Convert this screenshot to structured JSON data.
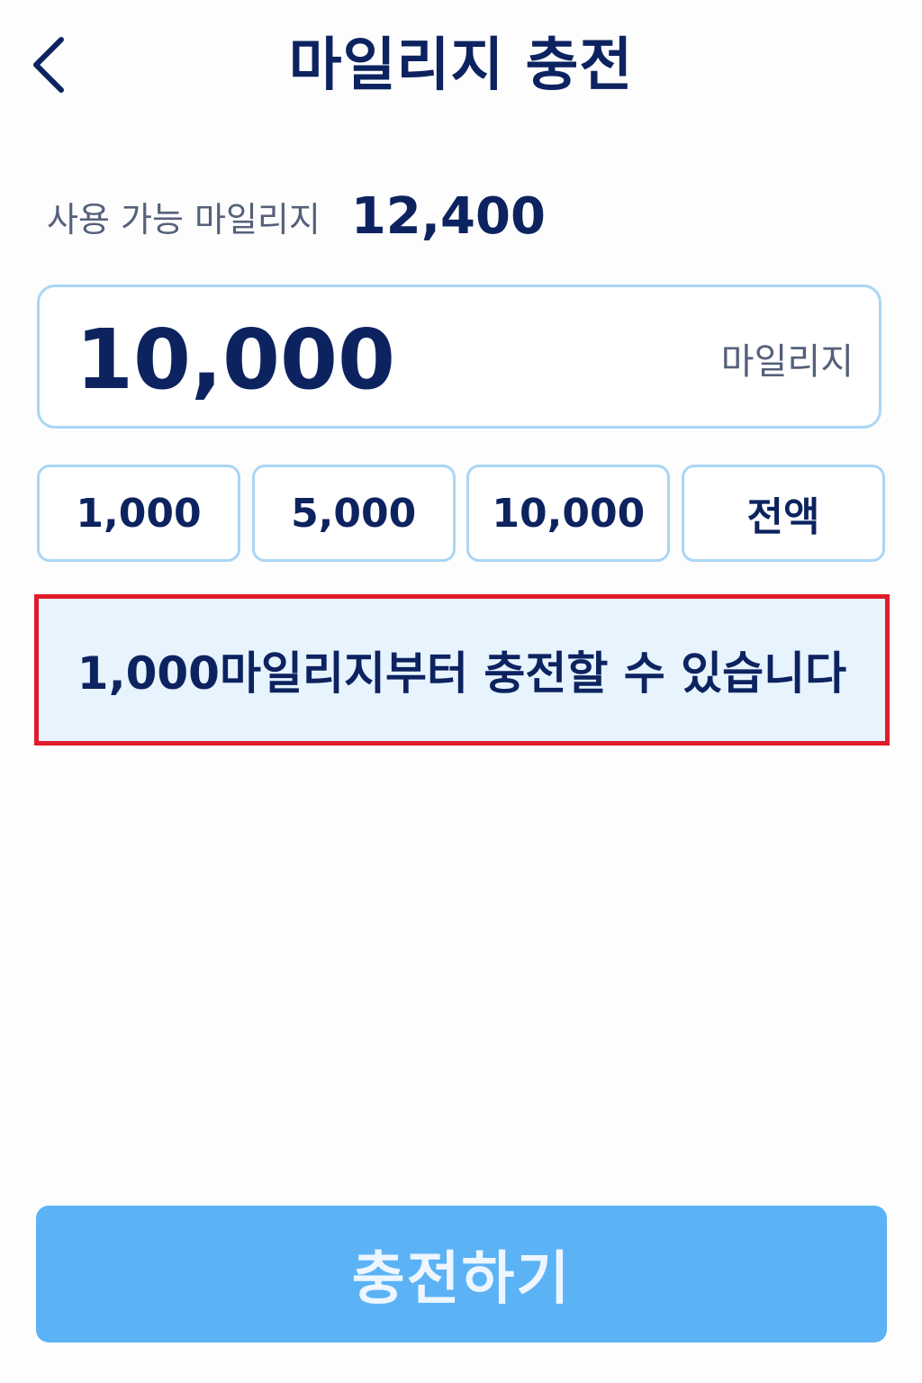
{
  "header": {
    "title": "마일리지 충전",
    "back_icon": "chevron-left-icon"
  },
  "balance": {
    "label": "사용 가능 마일리지",
    "value": "12,400"
  },
  "amount": {
    "value": "10,000",
    "unit": "마일리지"
  },
  "quick_amounts": [
    "1,000",
    "5,000",
    "10,000",
    "전액"
  ],
  "notice": {
    "text": "1,000마일리지부터 충전할 수 있습니다",
    "border_color": "#e01b2b",
    "background_color": "#e7f3fd"
  },
  "charge_button": {
    "label": "충전하기",
    "color": "#5bb3f6"
  },
  "colors": {
    "primary_text": "#0d2360",
    "secondary_text": "#55617a",
    "input_border": "#a9d6f5"
  }
}
